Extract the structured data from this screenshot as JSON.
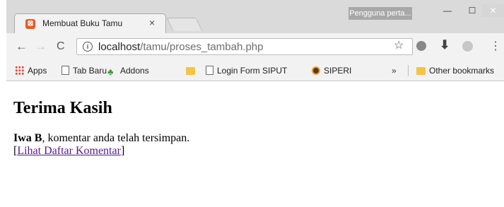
{
  "browser": {
    "tab": {
      "title": "Membuat Buku Tamu",
      "close": "×",
      "favicon_glyph": "⊠"
    },
    "profile": "Pengguna perta...",
    "window_controls": {
      "minimize": "—",
      "maximize": "☐",
      "close": "✕"
    },
    "nav": {
      "back": "←",
      "forward": "→",
      "reload": "C"
    },
    "address": {
      "info_glyph": "i",
      "host": "localhost",
      "path": "/tamu/proses_tambah.php"
    },
    "toolbar_icons": {
      "star": "☆",
      "download": "⬇",
      "menu": "⋮"
    },
    "bookmarks": [
      {
        "icon": "apps-icon",
        "label": "Apps"
      },
      {
        "icon": "page-icon",
        "label": "Tab Baru"
      },
      {
        "icon": "addons-icon",
        "label": "Addons"
      },
      {
        "icon": "folder-icon",
        "label": ""
      },
      {
        "icon": "page-icon",
        "label": "Login Form SIPUT"
      },
      {
        "icon": "siperi-icon",
        "label": "SIPERI"
      }
    ],
    "bookmarks_more": "»",
    "other_bookmarks": "Other bookmarks"
  },
  "page": {
    "heading": "Terima Kasih",
    "user_name": "Iwa B",
    "message": ", komentar anda telah tersimpan.",
    "bracket_open": "[",
    "link_label": "Lihat Daftar Komentar",
    "bracket_close": "]"
  },
  "colors": {
    "link": "#551a8b",
    "tab_favicon": "#e45c2a",
    "folder": "#f6c342"
  }
}
